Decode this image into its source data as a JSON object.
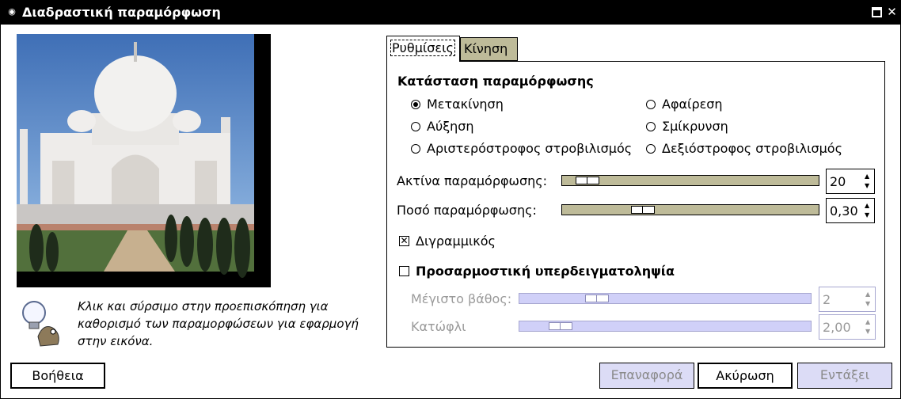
{
  "window": {
    "title": "Διαδραστική παραμόρφωση"
  },
  "hint": {
    "text": "Κλικ και σύρσιμο στην προεπισκόπηση για καθορισμό των παραμορφώσεων για εφαρμογή στην εικόνα."
  },
  "tabs": [
    {
      "label": "Ρυθμίσεις",
      "active": true
    },
    {
      "label": "Κίνηση",
      "active": false
    }
  ],
  "settings": {
    "mode_title": "Κατάσταση παραμόρφωσης",
    "modes": [
      {
        "label": "Μετακίνηση",
        "selected": true
      },
      {
        "label": "Αφαίρεση",
        "selected": false
      },
      {
        "label": "Αύξηση",
        "selected": false
      },
      {
        "label": "Σμίκρυνση",
        "selected": false
      },
      {
        "label": "Αριστερόστροφος στροβιλισμός",
        "selected": false
      },
      {
        "label": "Δεξιόστροφος στροβιλισμός",
        "selected": false
      }
    ],
    "radius": {
      "label": "Ακτίνα παραμόρφωσης:",
      "value": "20"
    },
    "amount": {
      "label": "Ποσό παραμόρφωσης:",
      "value": "0,30"
    },
    "bilinear": {
      "label": "Διγραμμικός",
      "checked": true
    },
    "supersampling": {
      "label": "Προσαρμοστική υπερδειγματοληψία",
      "checked": false,
      "max_depth": {
        "label": "Μέγιστο βάθος:",
        "value": "2"
      },
      "threshold": {
        "label": "Κατώφλι",
        "value": "2,00"
      }
    }
  },
  "buttons": {
    "help": "Βοήθεια",
    "reset": "Επαναφορά",
    "cancel": "Ακύρωση",
    "ok": "Εντάξει"
  },
  "colors": {
    "title_bar": "#000000",
    "slider_trough": "#bebb99",
    "disabled_trough": "#d0d0f8",
    "tab_inactive": "#bebb99"
  }
}
